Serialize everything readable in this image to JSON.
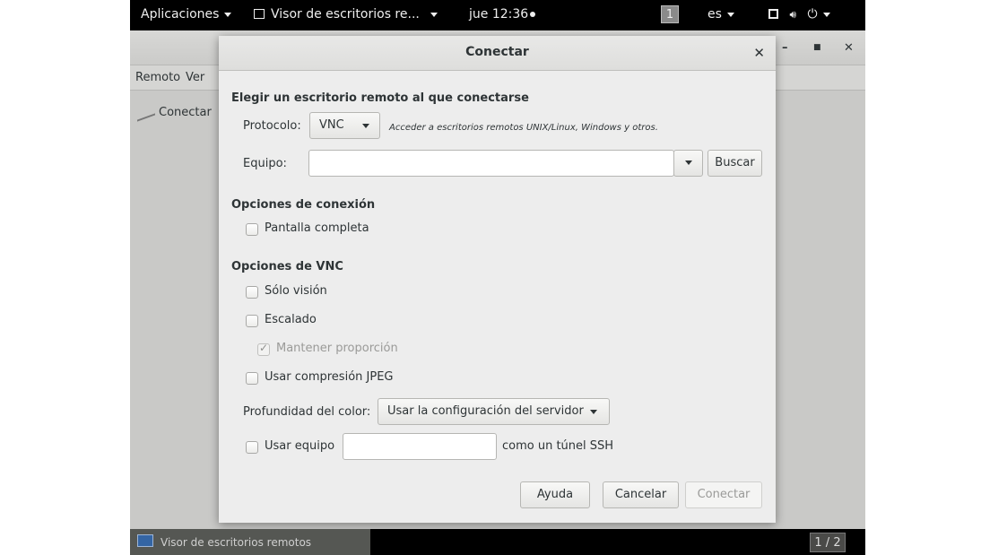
{
  "topbar": {
    "applications": "Aplicaciones",
    "window_menu": "Visor de escritorios re...",
    "clock": "jue 12:36",
    "workspace_number": "1",
    "language": "es"
  },
  "app": {
    "menu": [
      "Remoto",
      "Ver"
    ],
    "toolbar_connect": "Conectar"
  },
  "dialog": {
    "title": "Conectar",
    "section_choose": "Elegir un escritorio remoto al que conectarse",
    "protocol_label": "Protocolo:",
    "protocol_value": "VNC",
    "protocol_hint": "Acceder a escritorios remotos UNIX/Linux, Windows y otros.",
    "host_label": "Equipo:",
    "host_value": "",
    "search_button": "Buscar",
    "section_connection": "Opciones de conexión",
    "fullscreen": "Pantalla completa",
    "section_vnc": "Opciones de VNC",
    "view_only": "Sólo visión",
    "scaling": "Escalado",
    "keep_ratio": "Mantener proporción",
    "jpeg": "Usar compresión JPEG",
    "color_depth_label": "Profundidad del color:",
    "color_depth_value": "Usar la configuración del servidor",
    "ssh_use": "Usar equipo",
    "ssh_host_value": "",
    "ssh_suffix": "como un túnel SSH",
    "help_button": "Ayuda",
    "cancel_button": "Cancelar",
    "connect_button": "Conectar",
    "checkbox_states": {
      "fullscreen": false,
      "view_only": false,
      "scaling": false,
      "keep_ratio": true,
      "jpeg": false,
      "ssh": false
    }
  },
  "taskbar": {
    "task_label": "Visor de escritorios remotos",
    "pager": "1 / 2"
  }
}
